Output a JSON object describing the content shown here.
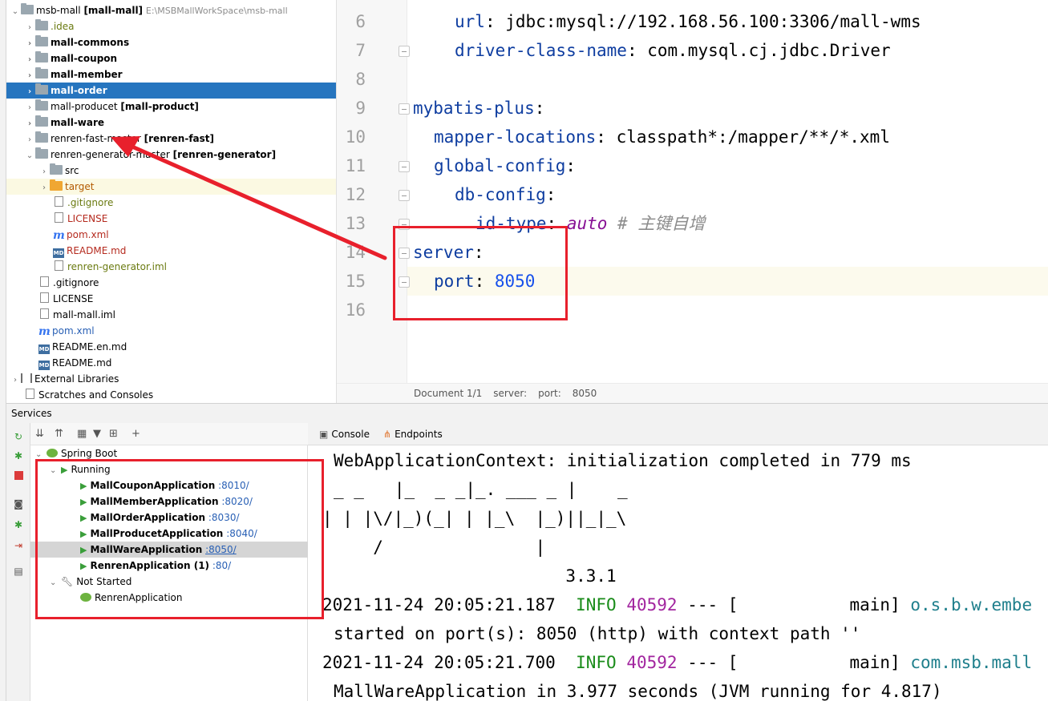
{
  "project": {
    "root": {
      "name": "msb-mall",
      "module": "[mall-mall]",
      "path": "E:\\MSBMallWorkSpace\\msb-mall"
    },
    "items": [
      {
        "label": ".idea"
      },
      {
        "label": "mall-commons"
      },
      {
        "label": "mall-coupon"
      },
      {
        "label": "mall-member"
      },
      {
        "label": "mall-order"
      },
      {
        "label": "mall-producet",
        "module": "[mall-product]"
      },
      {
        "label": "mall-ware"
      },
      {
        "label": "renren-fast-master",
        "module": "[renren-fast]"
      },
      {
        "label": "renren-generator-master",
        "module": "[renren-generator]"
      },
      {
        "label": "src"
      },
      {
        "label": "target"
      },
      {
        "label": ".gitignore"
      },
      {
        "label": "LICENSE"
      },
      {
        "label": "pom.xml"
      },
      {
        "label": "README.md"
      },
      {
        "label": "renren-generator.iml"
      },
      {
        "label": ".gitignore"
      },
      {
        "label": "LICENSE"
      },
      {
        "label": "mall-mall.iml"
      },
      {
        "label": "pom.xml"
      },
      {
        "label": "README.en.md"
      },
      {
        "label": "README.md"
      },
      {
        "label": "External Libraries"
      },
      {
        "label": "Scratches and Consoles"
      }
    ]
  },
  "editor": {
    "line_numbers": [
      "6",
      "7",
      "8",
      "9",
      "10",
      "11",
      "12",
      "13",
      "14",
      "15",
      "16"
    ],
    "l6": {
      "key": "url",
      "value": "jdbc:mysql://192.168.56.100:3306/mall-wms"
    },
    "l7": {
      "key": "driver-class-name",
      "value": "com.mysql.cj.jdbc.Driver"
    },
    "l9": {
      "key": "mybatis-plus"
    },
    "l10": {
      "key": "mapper-locations",
      "value": "classpath*:/mapper/**/*.xml"
    },
    "l11": {
      "key": "global-config"
    },
    "l12": {
      "key": "db-config"
    },
    "l13": {
      "key": "id-type",
      "value": "auto",
      "comment": "# 主键自增"
    },
    "l14": {
      "key": "server"
    },
    "l15": {
      "key": "port",
      "value": "8050"
    },
    "breadcrumb": [
      "Document 1/1",
      "server:",
      "port:",
      "8050"
    ]
  },
  "services": {
    "title": "Services",
    "spring_boot": "Spring Boot",
    "running": "Running",
    "apps": [
      {
        "name": "MallCouponApplication",
        "port": ":8010/"
      },
      {
        "name": "MallMemberApplication",
        "port": ":8020/"
      },
      {
        "name": "MallOrderApplication",
        "port": ":8030/"
      },
      {
        "name": "MallProducetApplication",
        "port": ":8040/"
      },
      {
        "name": "MallWareApplication",
        "port": ":8050/"
      },
      {
        "name": "RenrenApplication (1)",
        "port": ":80/"
      }
    ],
    "not_started": "Not Started",
    "not_started_app": "RenrenApplication"
  },
  "console": {
    "tabs": [
      "Console",
      "Endpoints"
    ],
    "lines": [
      "WebApplicationContext: initialization completed in 779 ms",
      "_ _   |_  _ _|_. ___ _ |    _",
      "| | |\\/|_)(_| | |_\\  |_)||_|_\\",
      "     /               |",
      "                        3.3.1"
    ],
    "log1": {
      "time": "2021-11-24 20:05:21.187",
      "level": "INFO",
      "pid": "40592",
      "sep": "--- [",
      "thread": "main]",
      "logger": "o.s.b.w.embe"
    },
    "log1_cont": "started on port(s): 8050 (http) with context path ''",
    "log2": {
      "time": "2021-11-24 20:05:21.700",
      "level": "INFO",
      "pid": "40592",
      "sep": "--- [",
      "thread": "main]",
      "logger": "com.msb.mall"
    },
    "log2_cont": "MallWareApplication in 3.977 seconds (JVM running for 4.817)"
  }
}
